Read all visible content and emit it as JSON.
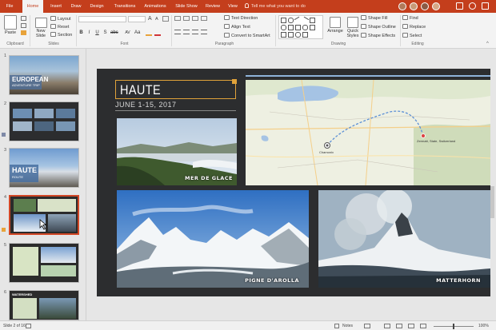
{
  "tabs": [
    {
      "label": "File",
      "active": false
    },
    {
      "label": "Home",
      "active": true
    },
    {
      "label": "Insert",
      "active": false
    },
    {
      "label": "Draw",
      "active": false
    },
    {
      "label": "Design",
      "active": false
    },
    {
      "label": "Transitions",
      "active": false
    },
    {
      "label": "Animations",
      "active": false
    },
    {
      "label": "Slide Show",
      "active": false
    },
    {
      "label": "Review",
      "active": false
    },
    {
      "label": "View",
      "active": false
    }
  ],
  "tell_me": "Tell me what you want to do",
  "ribbon": {
    "clipboard": {
      "paste": "Paste",
      "label": "Clipboard"
    },
    "slides": {
      "new_slide": "New Slide",
      "layout": "Layout",
      "reset": "Reset",
      "section": "Section",
      "label": "Slides"
    },
    "font": {
      "label": "Font",
      "size": "A"
    },
    "paragraph": {
      "text_direction": "Text Direction",
      "align_text": "Align Text",
      "convert_smartart": "Convert to SmartArt",
      "label": "Paragraph"
    },
    "drawing": {
      "arrange": "Arrange",
      "quick_styles": "Quick Styles",
      "shape_fill": "Shape Fill",
      "shape_outline": "Shape Outline",
      "shape_effects": "Shape Effects",
      "label": "Drawing"
    },
    "editing": {
      "find": "Find",
      "replace": "Replace",
      "select": "Select",
      "label": "Editing"
    }
  },
  "thumbnails": [
    {
      "num": "1",
      "title": "EUROPEAN",
      "subtitle": "ADVENTURE TRIP",
      "selected": false
    },
    {
      "num": "2",
      "title": "",
      "subtitle": "",
      "selected": false
    },
    {
      "num": "3",
      "title": "HAUTE",
      "subtitle": "ROUTE",
      "selected": false
    },
    {
      "num": "4",
      "title": "",
      "subtitle": "",
      "selected": true
    },
    {
      "num": "5",
      "title": "",
      "subtitle": "",
      "selected": false
    },
    {
      "num": "6",
      "title": "WATERSHED",
      "subtitle": "",
      "selected": false
    }
  ],
  "slide": {
    "title": "HAUTE",
    "date": "JUNE 1-15, 2017",
    "photos": {
      "mer_de_glace": "MER DE GLACE",
      "pigne_arolla": "PIGNE D'AROLLA",
      "matterhorn": "MATTERHORN"
    },
    "map_labels": {
      "zermatt": "Zermatt, State, Switzerland",
      "chamonix": "Chamonix"
    }
  },
  "status": {
    "slide_info": "Slide 2 of 16",
    "notes": "Notes",
    "zoom": "100%"
  },
  "colors": {
    "accent": "#c43e1c",
    "title_border": "#e0a23a",
    "slide_bg": "#2c2d2f"
  }
}
